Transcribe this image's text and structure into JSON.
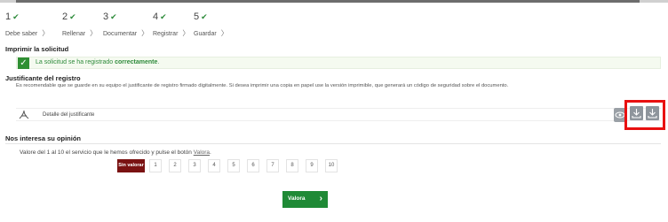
{
  "steps": [
    {
      "number": "1",
      "label": "Debe saber"
    },
    {
      "number": "2",
      "label": "Rellenar"
    },
    {
      "number": "3",
      "label": "Documentar"
    },
    {
      "number": "4",
      "label": "Registrar"
    },
    {
      "number": "5",
      "label": "Guardar"
    }
  ],
  "step_check_icon": "check-icon",
  "print": {
    "title": "Imprimir la solicitud",
    "success_prefix": "La solicitud se ha registrado",
    "success_strong": "correctamente",
    "success_suffix": "."
  },
  "justificante": {
    "title": "Justificante del registro",
    "description": "Es recomendable que se guarde en su equipo el justificante de registro firmado digitalmente. Si desea imprimir una copia en papel use la versión imprimible, que generará un código de seguridad sobre el documento.",
    "file_name": "Detalle del justificante"
  },
  "opinion": {
    "title": "Nos interesa su opinión",
    "prompt_prefix": "Valore del 1 al 10 el servicio que le hemos ofrecido y pulse el botón",
    "prompt_link": "Valora",
    "prompt_suffix": ".",
    "selected_label": "Sin valorar",
    "options": [
      "1",
      "2",
      "3",
      "4",
      "5",
      "6",
      "7",
      "8",
      "9",
      "10"
    ],
    "submit_label": "Valora"
  },
  "colors": {
    "success_green": "#2f8f33",
    "selected_red": "#7a1212",
    "highlight_red": "#e81010",
    "button_gray": "#8e959c"
  }
}
